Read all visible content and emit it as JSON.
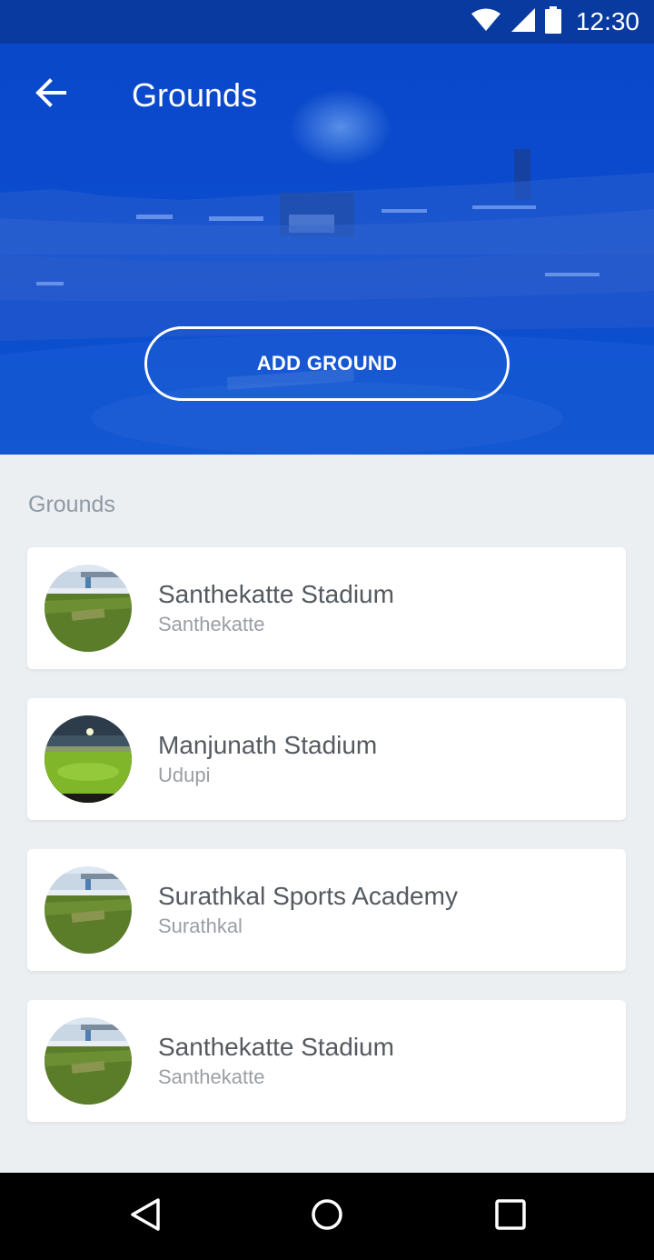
{
  "status_bar": {
    "time": "12:30",
    "icons": [
      "wifi-icon",
      "signal-icon",
      "battery-icon"
    ]
  },
  "app_bar": {
    "title": "Grounds",
    "back_icon": "arrow-left-icon"
  },
  "hero": {
    "add_button_label": "ADD GROUND"
  },
  "section": {
    "label": "Grounds"
  },
  "grounds": [
    {
      "name": "Santhekatte Stadium",
      "location": "Santhekatte",
      "thumb": "day"
    },
    {
      "name": "Manjunath Stadium",
      "location": "Udupi",
      "thumb": "night"
    },
    {
      "name": "Surathkal Sports Academy",
      "location": "Surathkal",
      "thumb": "day"
    },
    {
      "name": "Santhekatte Stadium",
      "location": "Santhekatte",
      "thumb": "day"
    }
  ],
  "nav": {
    "back": "back-triangle-icon",
    "home": "home-circle-icon",
    "recents": "recents-square-icon"
  },
  "colors": {
    "primary": "#0b4bcd",
    "status_bar": "#083a9f",
    "background": "#eceff2"
  }
}
